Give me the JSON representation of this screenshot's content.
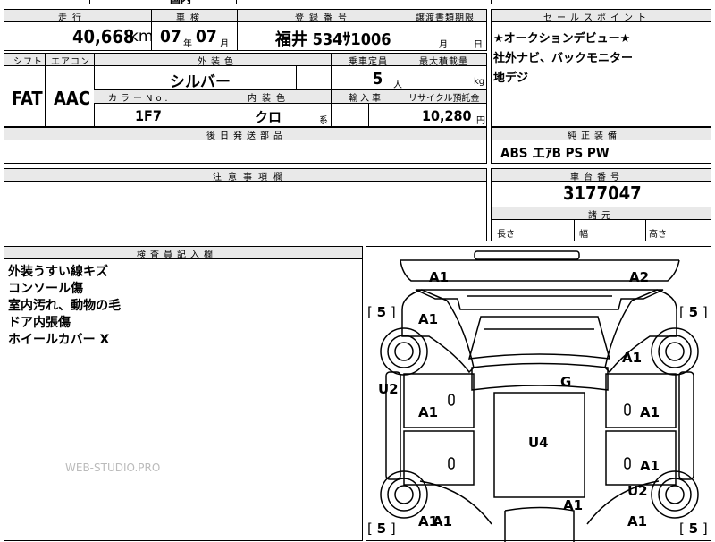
{
  "top_strip": {
    "cut_text": "国内"
  },
  "basic": {
    "headers": {
      "mileage": "走行",
      "inspection": "車検",
      "registration": "登録番号",
      "transfer_deadline": "譲渡書類期限"
    },
    "mileage_value": "40,668",
    "mileage_unit": "km",
    "inspection_year": "07",
    "inspection_year_unit": "年",
    "inspection_month": "07",
    "inspection_month_unit": "月",
    "registration_value": "福井 534ｻ1006",
    "transfer_month_unit": "月",
    "transfer_day_unit": "日"
  },
  "specs": {
    "headers": {
      "shift": "シフト",
      "aircon": "エアコン",
      "exterior_color": "外装色",
      "capacity": "乗車定員",
      "max_load": "最大積載量"
    },
    "shift": "FAT",
    "aircon": "AAC",
    "exterior_color": "シルバー",
    "capacity": "5",
    "capacity_unit": "人",
    "max_load_unit": "kg",
    "sub_headers": {
      "color_no": "カラーNo.",
      "interior_color": "内装色",
      "import": "輸入車",
      "recycle": "リサイクル預託金"
    },
    "color_no": "1F7",
    "interior_color": "クロ",
    "interior_suffix": "系",
    "recycle_value": "10,280",
    "recycle_unit": "円"
  },
  "later_parts": {
    "header": "後日発送部品"
  },
  "notes": {
    "header": "注意事項欄"
  },
  "sales_points": {
    "header": "セールスポイント",
    "lines": [
      "★オークションデビュー★",
      "社外ナビ、バックモニター",
      "地デジ"
    ]
  },
  "equipment": {
    "header": "純正装備",
    "value": "ABS エｱB PS PW"
  },
  "chassis": {
    "header": "車台番号",
    "value": "3177047"
  },
  "dimensions": {
    "header": "諸元",
    "length": "長さ",
    "width": "幅",
    "height": "高さ"
  },
  "inspector": {
    "header": "検査員記入欄",
    "lines": [
      "外装うすい線キズ",
      "コンソール傷",
      "室内汚れ、動物の毛",
      "ドア内張傷",
      "ホイールカバー X"
    ],
    "watermark": "WEB-STUDIO.PRO"
  },
  "diagram": {
    "marks": {
      "front_left": "A1",
      "front_right": "A2",
      "fender_left": "A1",
      "fender_right": "A1",
      "roof": "G",
      "door_fl": "A1",
      "door_fr": "A1",
      "door_rl": "A1",
      "door_rr": "A1",
      "rear_left": "A1",
      "rear_right": "A1",
      "trunk": "A1",
      "floor": "U4",
      "step_left": "U2",
      "step_right": "U2",
      "tire_fl": "5",
      "tire_fr": "5",
      "tire_rl": "5",
      "tire_rr": "5",
      "pillar_marks": "0"
    }
  }
}
